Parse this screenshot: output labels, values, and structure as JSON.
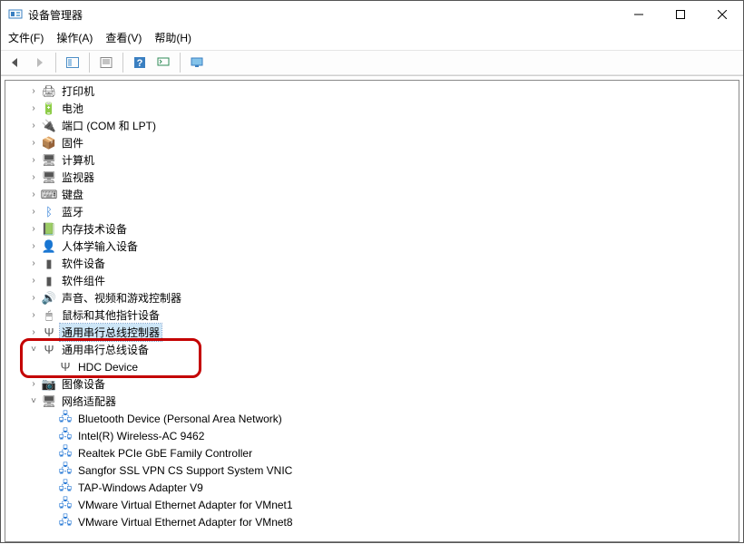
{
  "window": {
    "title": "设备管理器"
  },
  "menu": {
    "file": "文件(F)",
    "action": "操作(A)",
    "view": "查看(V)",
    "help": "帮助(H)"
  },
  "tree": {
    "items": [
      {
        "indent": 1,
        "expander": "›",
        "icon": "🖨",
        "label": "打印机"
      },
      {
        "indent": 1,
        "expander": "›",
        "icon": "🔋",
        "label": "电池"
      },
      {
        "indent": 1,
        "expander": "›",
        "icon": "🔌",
        "label": "端口 (COM 和 LPT)"
      },
      {
        "indent": 1,
        "expander": "›",
        "icon": "📦",
        "label": "固件"
      },
      {
        "indent": 1,
        "expander": "›",
        "icon": "🖥",
        "label": "计算机"
      },
      {
        "indent": 1,
        "expander": "›",
        "icon": "🖥",
        "label": "监视器"
      },
      {
        "indent": 1,
        "expander": "›",
        "icon": "⌨",
        "label": "键盘"
      },
      {
        "indent": 1,
        "expander": "›",
        "icon": "ᛒ",
        "label": "蓝牙",
        "iconColor": "#2b7bd6"
      },
      {
        "indent": 1,
        "expander": "›",
        "icon": "📗",
        "label": "内存技术设备"
      },
      {
        "indent": 1,
        "expander": "›",
        "icon": "👤",
        "label": "人体学输入设备"
      },
      {
        "indent": 1,
        "expander": "›",
        "icon": "▮",
        "label": "软件设备"
      },
      {
        "indent": 1,
        "expander": "›",
        "icon": "▮",
        "label": "软件组件"
      },
      {
        "indent": 1,
        "expander": "›",
        "icon": "🔊",
        "label": "声音、视频和游戏控制器"
      },
      {
        "indent": 1,
        "expander": "›",
        "icon": "🖱",
        "label": "鼠标和其他指针设备"
      },
      {
        "indent": 1,
        "expander": "›",
        "icon": "Ψ",
        "label": "通用串行总线控制器",
        "selected": true
      },
      {
        "indent": 1,
        "expander": "˅",
        "icon": "Ψ",
        "label": "通用串行总线设备"
      },
      {
        "indent": 2,
        "expander": "",
        "icon": "Ψ",
        "label": "HDC Device"
      },
      {
        "indent": 1,
        "expander": "›",
        "icon": "📷",
        "label": "图像设备"
      },
      {
        "indent": 1,
        "expander": "˅",
        "icon": "🖥",
        "label": "网络适配器"
      },
      {
        "indent": 2,
        "expander": "",
        "icon": "🖧",
        "label": "Bluetooth Device (Personal Area Network)",
        "iconColor": "#2b7bd6"
      },
      {
        "indent": 2,
        "expander": "",
        "icon": "🖧",
        "label": "Intel(R) Wireless-AC 9462",
        "iconColor": "#2b7bd6"
      },
      {
        "indent": 2,
        "expander": "",
        "icon": "🖧",
        "label": "Realtek PCIe GbE Family Controller",
        "iconColor": "#2b7bd6"
      },
      {
        "indent": 2,
        "expander": "",
        "icon": "🖧",
        "label": "Sangfor SSL VPN CS Support System VNIC",
        "iconColor": "#2b7bd6"
      },
      {
        "indent": 2,
        "expander": "",
        "icon": "🖧",
        "label": "TAP-Windows Adapter V9",
        "iconColor": "#2b7bd6"
      },
      {
        "indent": 2,
        "expander": "",
        "icon": "🖧",
        "label": "VMware Virtual Ethernet Adapter for VMnet1",
        "iconColor": "#2b7bd6"
      },
      {
        "indent": 2,
        "expander": "",
        "icon": "🖧",
        "label": "VMware Virtual Ethernet Adapter for VMnet8",
        "iconColor": "#2b7bd6"
      }
    ]
  }
}
